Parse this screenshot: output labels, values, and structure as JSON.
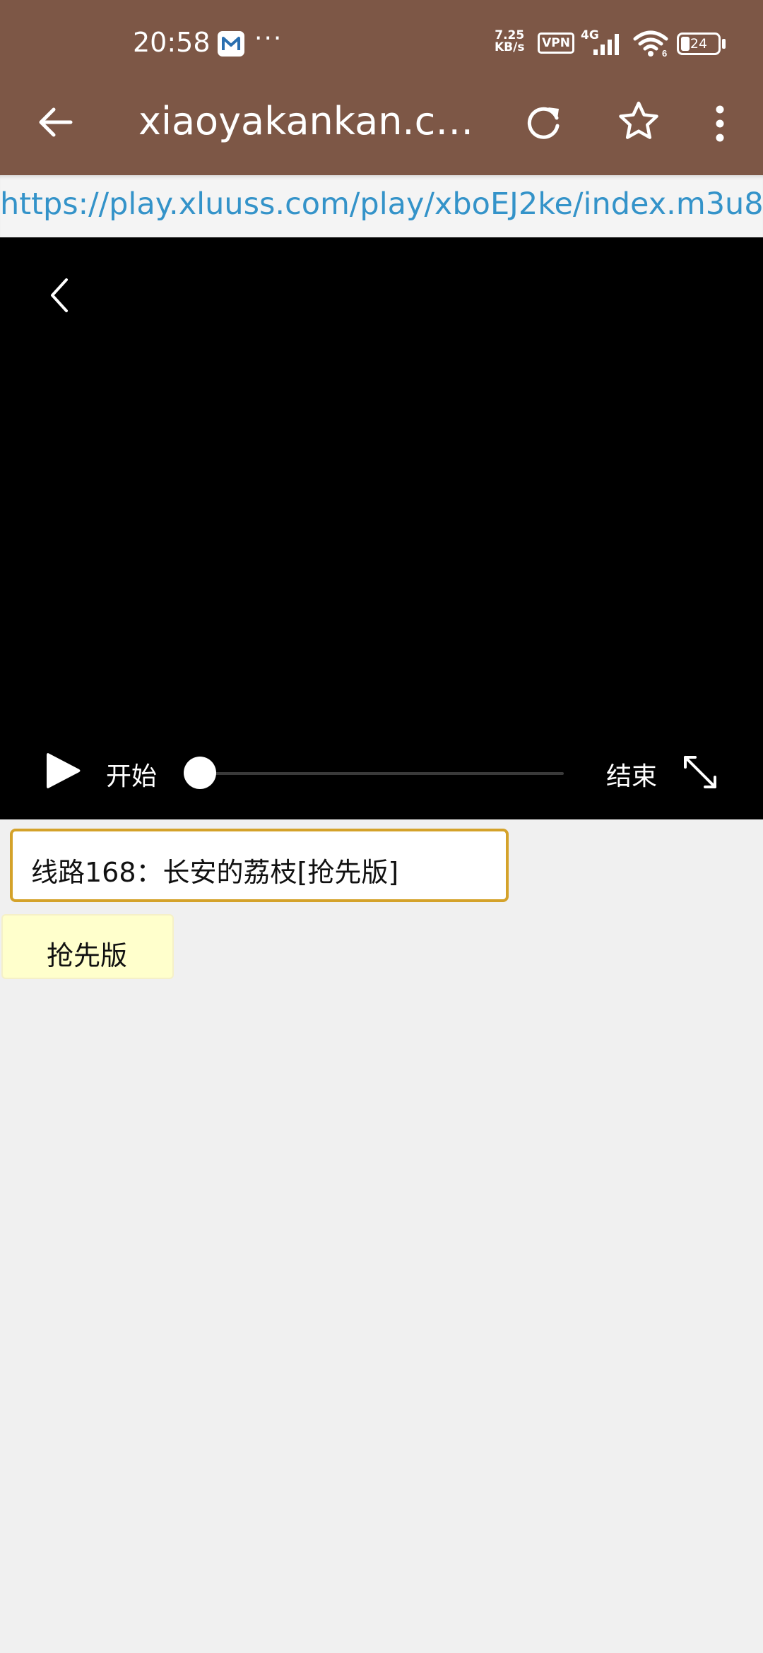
{
  "status_bar": {
    "time": "20:58",
    "notification_icon": "m-app-icon",
    "more_notifications": "···",
    "net_speed_value": "7.25",
    "net_speed_unit": "KB/s",
    "vpn": "VPN",
    "network_type": "4G",
    "battery": "24",
    "battery_level_percent": 24
  },
  "browser": {
    "title": "xiaoyakankan.co...",
    "back_icon": "arrow-left-icon",
    "reload_icon": "reload-icon",
    "bookmark_icon": "star-icon",
    "menu_icon": "more-vertical-icon",
    "url": "https://play.xluuss.com/play/xboEJ2ke/index.m3u8"
  },
  "player": {
    "back_icon": "chevron-left-icon",
    "play_icon": "play-icon",
    "start_label": "开始",
    "end_label": "结束",
    "progress_percent": 0,
    "fullscreen_icon": "expand-icon"
  },
  "content": {
    "route_title": "线路168：长安的荔枝[抢先版]",
    "tag_label": "抢先版"
  },
  "colors": {
    "appbar": "#7d5746",
    "url_link": "#3493c9",
    "route_border": "#d4a22a",
    "tag_background": "#ffffcc",
    "page_background": "#f0f0f0"
  }
}
